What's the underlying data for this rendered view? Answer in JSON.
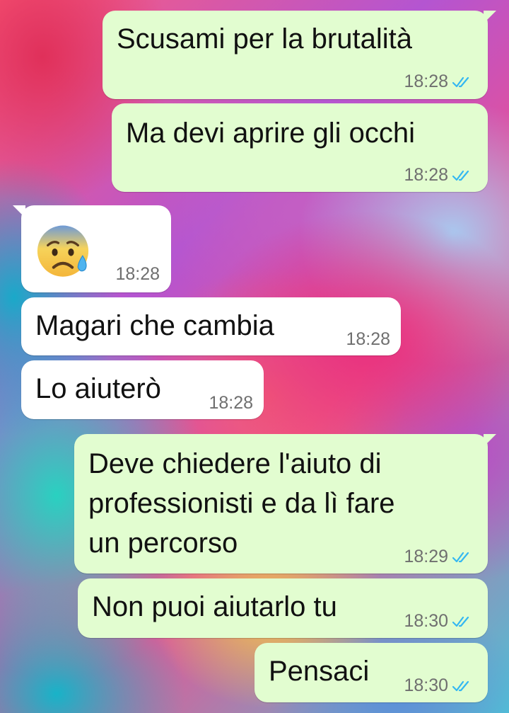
{
  "messages": [
    {
      "text": "Scusami per la brutalità",
      "time": "18:28",
      "direction": "outgoing",
      "status": "read"
    },
    {
      "text": "Ma devi aprire gli occhi",
      "time": "18:28",
      "direction": "outgoing",
      "status": "read"
    },
    {
      "emoji": "anxious-face-with-sweat",
      "time": "18:28",
      "direction": "incoming"
    },
    {
      "text": "Magari che cambia",
      "time": "18:28",
      "direction": "incoming"
    },
    {
      "text": "Lo aiuterò",
      "time": "18:28",
      "direction": "incoming"
    },
    {
      "text": "Deve chiedere l'aiuto di\nprofessionisti e da lì fare\nun percorso",
      "time": "18:29",
      "direction": "outgoing",
      "status": "read"
    },
    {
      "text": "Non puoi aiutarlo tu",
      "time": "18:30",
      "direction": "outgoing",
      "status": "read"
    },
    {
      "text": "Pensaci",
      "time": "18:30",
      "direction": "outgoing",
      "status": "read"
    }
  ],
  "colors": {
    "outgoing_bubble": "#e2fdd0",
    "incoming_bubble": "#ffffff",
    "read_ticks": "#34b7f1",
    "timestamp": "#6f6f6f"
  }
}
